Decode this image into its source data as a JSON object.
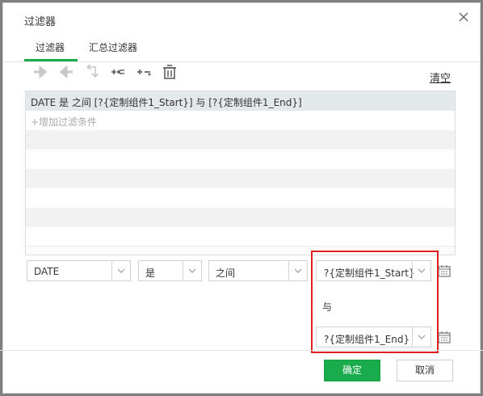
{
  "dialog": {
    "title": "过滤器"
  },
  "tabs": [
    {
      "label": "过滤器",
      "active": true
    },
    {
      "label": "汇总过滤器",
      "active": false
    }
  ],
  "toolbar": {
    "icons": [
      "arrow-right-icon",
      "arrow-left-icon",
      "return-arrow-icon",
      "add-condition-icon",
      "remove-condition-icon",
      "trash-icon"
    ],
    "clear_label": "清空"
  },
  "conditions": {
    "items": [
      "DATE 是 之间 [?{定制组件1_Start}] 与 [?{定制组件1_End}]"
    ],
    "add_placeholder": "+增加过滤条件"
  },
  "editor": {
    "field": "DATE",
    "operator_is": "是",
    "operator": "之间",
    "value_start": "?{定制组件1_Start}",
    "and_label": "与",
    "value_end": "?{定制组件1_End}"
  },
  "buttons": {
    "ok": "确定",
    "cancel": "取消"
  },
  "colors": {
    "accent": "#1aab4d",
    "highlight": "#e02020",
    "selected_row": "#e3e8eb"
  }
}
